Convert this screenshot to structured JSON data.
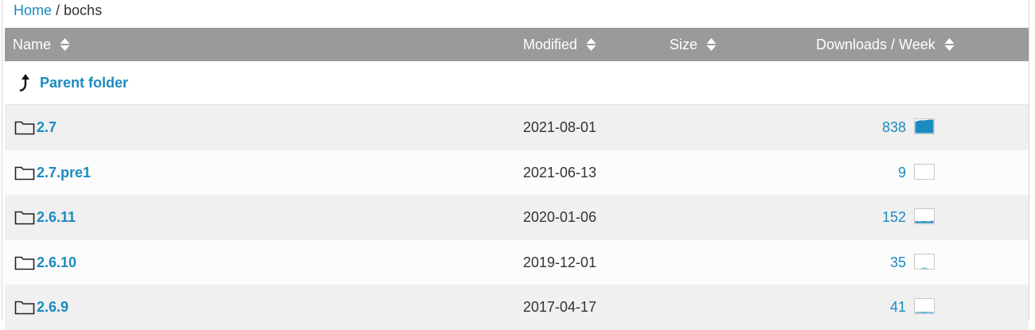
{
  "breadcrumb": {
    "home": "Home",
    "separator": " / ",
    "current": "bochs"
  },
  "columns": {
    "name": "Name",
    "modified": "Modified",
    "size": "Size",
    "downloads": "Downloads / Week"
  },
  "parent_folder": {
    "label": "Parent folder"
  },
  "rows": [
    {
      "name": "2.7",
      "modified": "2021-08-01",
      "size": "",
      "downloads": "838",
      "activity": [
        0.85,
        0.95,
        0.95,
        1.0,
        1.0
      ]
    },
    {
      "name": "2.7.pre1",
      "modified": "2021-06-13",
      "size": "",
      "downloads": "9",
      "activity": [
        0,
        0,
        0,
        0,
        0
      ]
    },
    {
      "name": "2.6.11",
      "modified": "2020-01-06",
      "size": "",
      "downloads": "152",
      "activity": [
        0.15,
        0.12,
        0.15,
        0.12,
        0.18
      ]
    },
    {
      "name": "2.6.10",
      "modified": "2019-12-01",
      "size": "",
      "downloads": "35",
      "activity": [
        0,
        0,
        0.06,
        0,
        0
      ]
    },
    {
      "name": "2.6.9",
      "modified": "2017-04-17",
      "size": "",
      "downloads": "41",
      "activity": [
        0.06,
        0.06,
        0.08,
        0.06,
        0.06
      ]
    }
  ],
  "colors": {
    "link": "#1a8bbf",
    "header_bg": "#9a9a9a",
    "row_alt": "#f0f0f0",
    "spark_fill": "#1a8bbf"
  },
  "icons": {
    "sort": "sort-icon",
    "up": "parent-folder-icon",
    "folder": "folder-icon",
    "activity": "sparkline-icon"
  }
}
